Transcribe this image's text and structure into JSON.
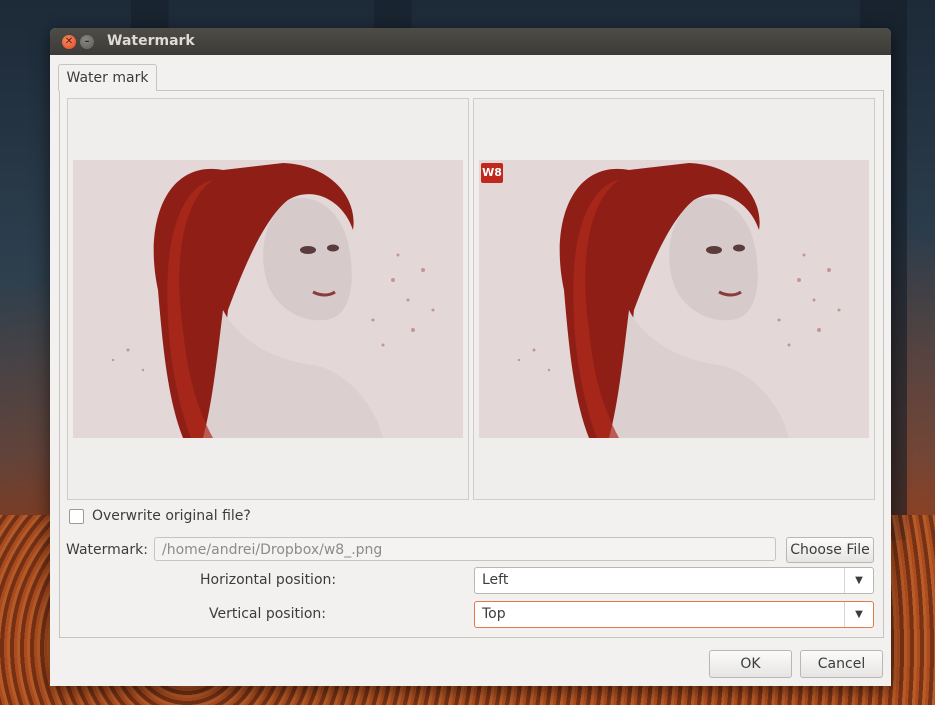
{
  "window": {
    "title": "Watermark"
  },
  "tabs": [
    {
      "label": "Water mark"
    }
  ],
  "preview": {
    "watermark_badge": "W8"
  },
  "overwrite": {
    "label": "Overwrite original file?",
    "checked": false
  },
  "watermark": {
    "label": "Watermark:",
    "path": "/home/andrei/Dropbox/w8_.png",
    "choose_label": "Choose File"
  },
  "horizontal": {
    "label": "Horizontal position:",
    "value": "Left"
  },
  "vertical": {
    "label": "Vertical position:",
    "value": "Top"
  },
  "buttons": {
    "ok": "OK",
    "cancel": "Cancel"
  },
  "icons": {
    "close": "close-icon",
    "minimize": "minimize-icon",
    "dropdown": "chevron-down-icon"
  },
  "colors": {
    "accent": "#e07a4c",
    "watermark_badge": "#c0271d",
    "titlebar": "#3c3b37"
  }
}
